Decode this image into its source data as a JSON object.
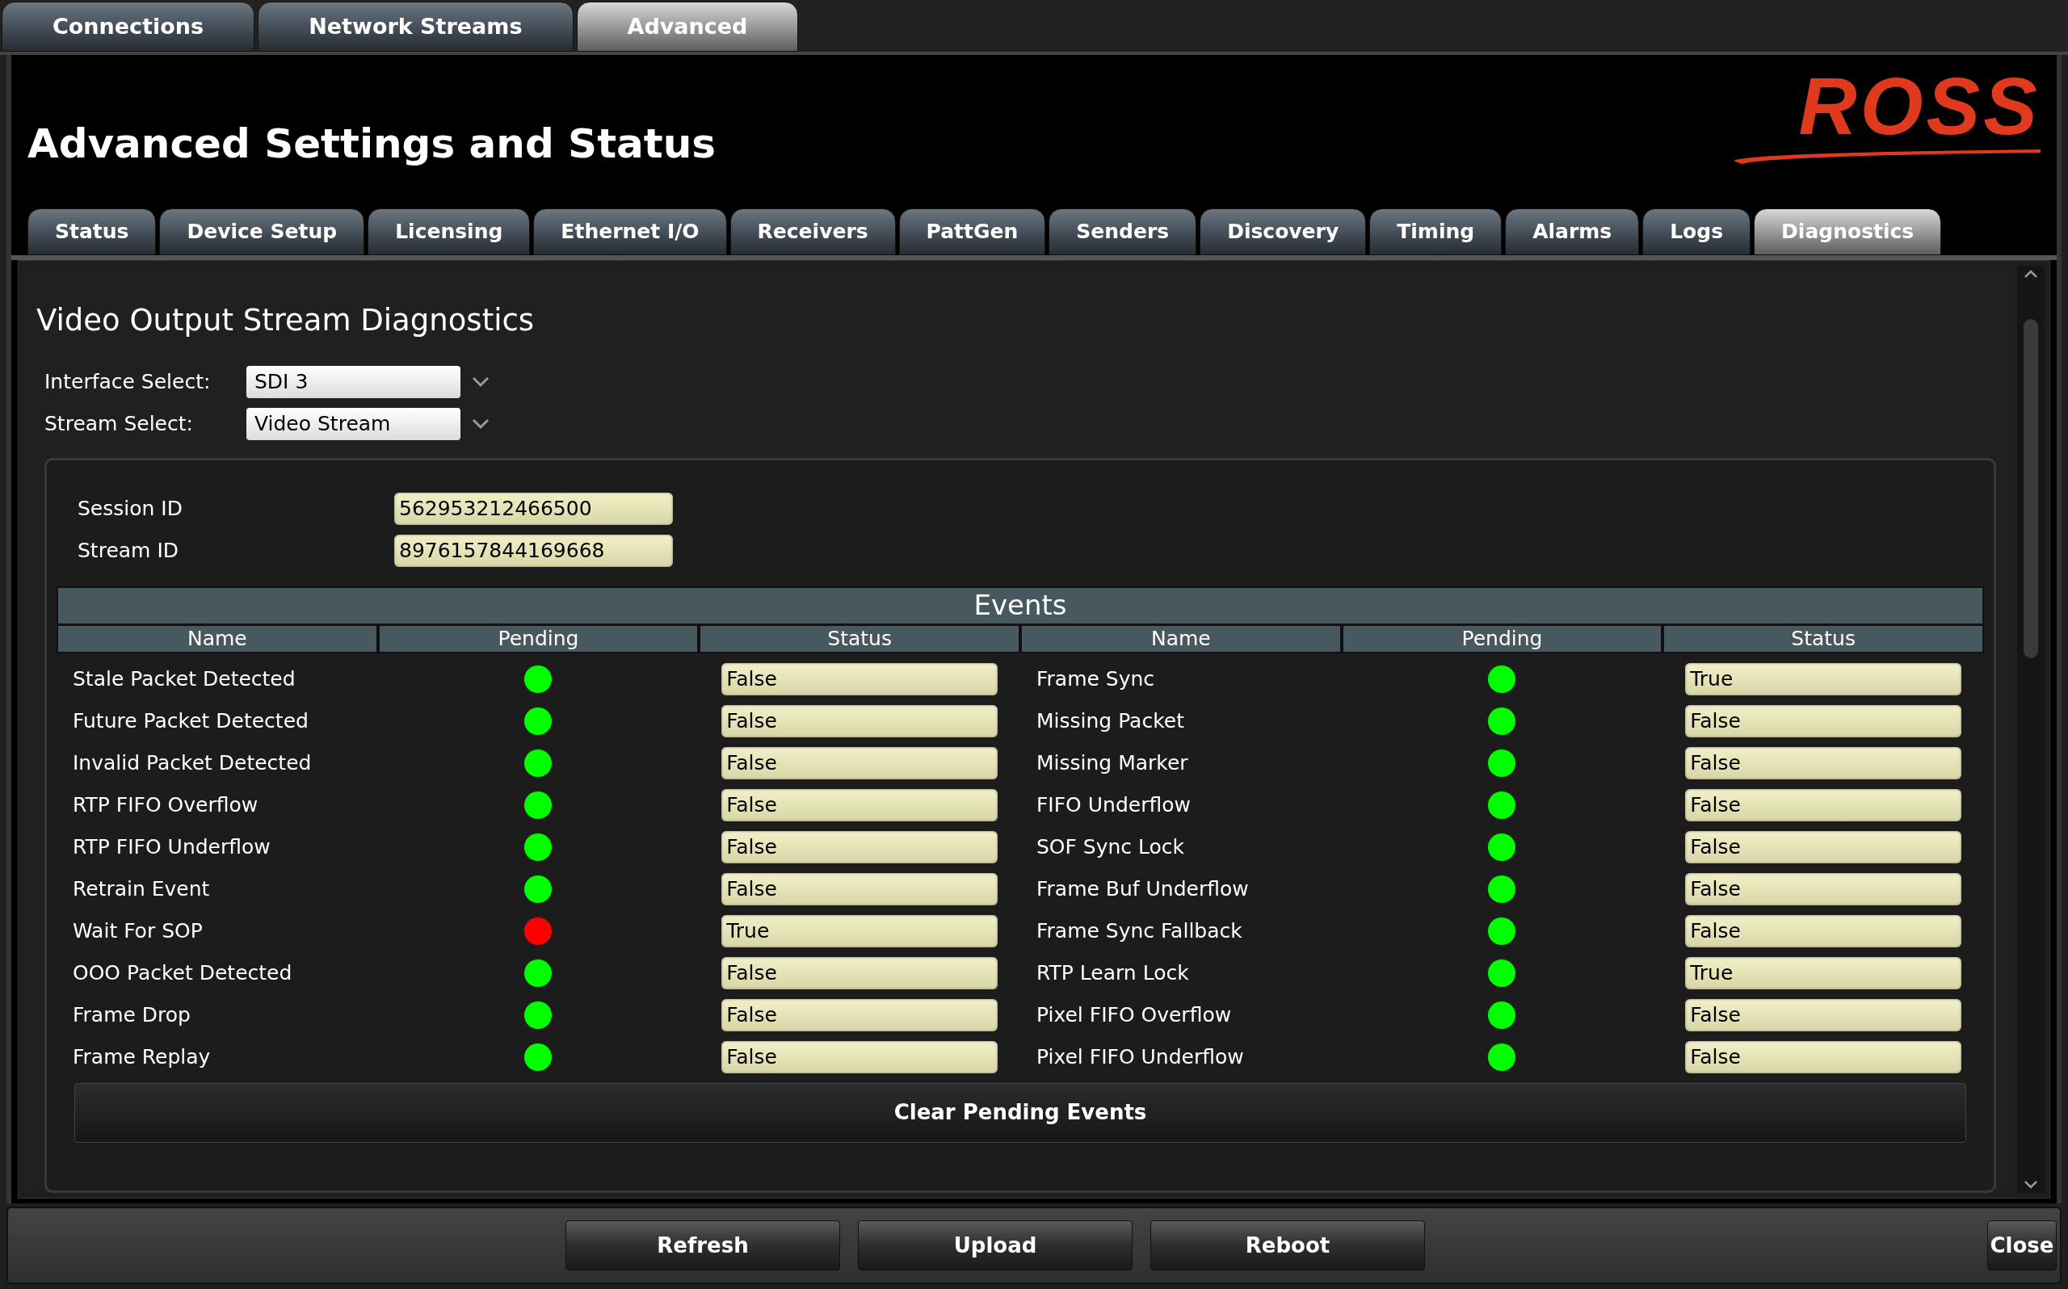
{
  "top_tabs": [
    {
      "label": "Connections",
      "selected": false
    },
    {
      "label": "Network Streams",
      "selected": false
    },
    {
      "label": "Advanced",
      "selected": true
    }
  ],
  "title": "Advanced Settings and Status",
  "logo": "ROSS",
  "tabs": [
    {
      "label": "Status",
      "selected": false
    },
    {
      "label": "Device Setup",
      "selected": false
    },
    {
      "label": "Licensing",
      "selected": false
    },
    {
      "label": "Ethernet I/O",
      "selected": false
    },
    {
      "label": "Receivers",
      "selected": false
    },
    {
      "label": "PattGen",
      "selected": false
    },
    {
      "label": "Senders",
      "selected": false
    },
    {
      "label": "Discovery",
      "selected": false
    },
    {
      "label": "Timing",
      "selected": false
    },
    {
      "label": "Alarms",
      "selected": false
    },
    {
      "label": "Logs",
      "selected": false
    },
    {
      "label": "Diagnostics",
      "selected": true
    }
  ],
  "section_title": "Video Output Stream Diagnostics",
  "selects": [
    {
      "label": "Interface Select:",
      "value": "SDI 3"
    },
    {
      "label": "Stream Select:",
      "value": "Video Stream"
    }
  ],
  "ids": [
    {
      "label": "Session ID",
      "value": "562953212466500"
    },
    {
      "label": "Stream ID",
      "value": "8976157844169668"
    }
  ],
  "events": {
    "title": "Events",
    "columns": [
      "Name",
      "Pending",
      "Status",
      "Name",
      "Pending",
      "Status"
    ],
    "rows": [
      {
        "cells": [
          {
            "kind": "name",
            "text": "Stale Packet Detected"
          },
          {
            "kind": "dot",
            "pending": false
          },
          {
            "kind": "status",
            "text": "False"
          },
          {
            "kind": "name",
            "text": "Frame Sync"
          },
          {
            "kind": "dot",
            "pending": false
          },
          {
            "kind": "status",
            "text": "True"
          }
        ]
      },
      {
        "cells": [
          {
            "kind": "name",
            "text": "Future Packet Detected"
          },
          {
            "kind": "dot",
            "pending": false
          },
          {
            "kind": "status",
            "text": "False"
          },
          {
            "kind": "name",
            "text": "Missing Packet"
          },
          {
            "kind": "dot",
            "pending": false
          },
          {
            "kind": "status",
            "text": "False"
          }
        ]
      },
      {
        "cells": [
          {
            "kind": "name",
            "text": "Invalid Packet Detected"
          },
          {
            "kind": "dot",
            "pending": false
          },
          {
            "kind": "status",
            "text": "False"
          },
          {
            "kind": "name",
            "text": "Missing Marker"
          },
          {
            "kind": "dot",
            "pending": false
          },
          {
            "kind": "status",
            "text": "False"
          }
        ]
      },
      {
        "cells": [
          {
            "kind": "name",
            "text": "RTP FIFO Overflow"
          },
          {
            "kind": "dot",
            "pending": false
          },
          {
            "kind": "status",
            "text": "False"
          },
          {
            "kind": "name",
            "text": "FIFO Underflow"
          },
          {
            "kind": "dot",
            "pending": false
          },
          {
            "kind": "status",
            "text": "False"
          }
        ]
      },
      {
        "cells": [
          {
            "kind": "name",
            "text": "RTP FIFO Underflow"
          },
          {
            "kind": "dot",
            "pending": false
          },
          {
            "kind": "status",
            "text": "False"
          },
          {
            "kind": "name",
            "text": "SOF Sync Lock"
          },
          {
            "kind": "dot",
            "pending": false
          },
          {
            "kind": "status",
            "text": "False"
          }
        ]
      },
      {
        "cells": [
          {
            "kind": "name",
            "text": "Retrain Event"
          },
          {
            "kind": "dot",
            "pending": false
          },
          {
            "kind": "status",
            "text": "False"
          },
          {
            "kind": "name",
            "text": "Frame Buf Underflow"
          },
          {
            "kind": "dot",
            "pending": false
          },
          {
            "kind": "status",
            "text": "False"
          }
        ]
      },
      {
        "cells": [
          {
            "kind": "name",
            "text": "Wait For SOP"
          },
          {
            "kind": "dot",
            "pending": true
          },
          {
            "kind": "status",
            "text": "True"
          },
          {
            "kind": "name",
            "text": "Frame Sync Fallback"
          },
          {
            "kind": "dot",
            "pending": false
          },
          {
            "kind": "status",
            "text": "False"
          }
        ]
      },
      {
        "cells": [
          {
            "kind": "name",
            "text": "OOO Packet Detected"
          },
          {
            "kind": "dot",
            "pending": false
          },
          {
            "kind": "status",
            "text": "False"
          },
          {
            "kind": "name",
            "text": "RTP Learn Lock"
          },
          {
            "kind": "dot",
            "pending": false
          },
          {
            "kind": "status",
            "text": "True"
          }
        ]
      },
      {
        "cells": [
          {
            "kind": "name",
            "text": "Frame Drop"
          },
          {
            "kind": "dot",
            "pending": false
          },
          {
            "kind": "status",
            "text": "False"
          },
          {
            "kind": "name",
            "text": "Pixel FIFO Overflow"
          },
          {
            "kind": "dot",
            "pending": false
          },
          {
            "kind": "status",
            "text": "False"
          }
        ]
      },
      {
        "cells": [
          {
            "kind": "name",
            "text": "Frame Replay"
          },
          {
            "kind": "dot",
            "pending": false
          },
          {
            "kind": "status",
            "text": "False"
          },
          {
            "kind": "name",
            "text": "Pixel FIFO Underflow"
          },
          {
            "kind": "dot",
            "pending": false
          },
          {
            "kind": "status",
            "text": "False"
          }
        ]
      }
    ]
  },
  "clear_button": "Clear Pending Events",
  "footer_buttons": [
    "Refresh",
    "Upload",
    "Reboot"
  ],
  "close_button": "Close"
}
